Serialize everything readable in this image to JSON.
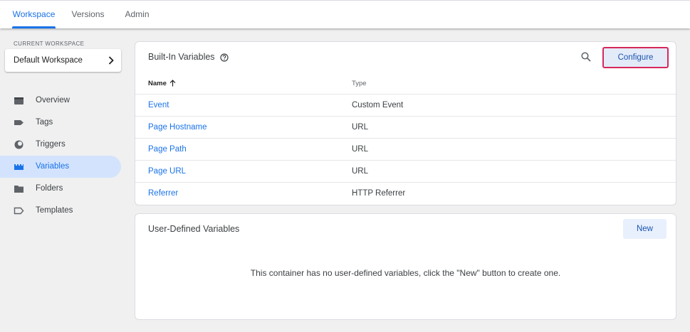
{
  "top_tabs": [
    {
      "label": "Workspace",
      "active": true
    },
    {
      "label": "Versions",
      "active": false
    },
    {
      "label": "Admin",
      "active": false
    }
  ],
  "sidebar": {
    "workspace_label": "CURRENT WORKSPACE",
    "workspace_name": "Default Workspace",
    "items": [
      {
        "label": "Overview",
        "icon": "overview-icon",
        "active": false
      },
      {
        "label": "Tags",
        "icon": "tag-icon",
        "active": false
      },
      {
        "label": "Triggers",
        "icon": "trigger-icon",
        "active": false
      },
      {
        "label": "Variables",
        "icon": "variables-icon",
        "active": true
      },
      {
        "label": "Folders",
        "icon": "folder-icon",
        "active": false
      },
      {
        "label": "Templates",
        "icon": "template-icon",
        "active": false
      }
    ]
  },
  "builtin": {
    "title": "Built-In Variables",
    "configure_label": "Configure",
    "columns": {
      "name": "Name",
      "type": "Type"
    },
    "rows": [
      {
        "name": "Event",
        "type": "Custom Event"
      },
      {
        "name": "Page Hostname",
        "type": "URL"
      },
      {
        "name": "Page Path",
        "type": "URL"
      },
      {
        "name": "Page URL",
        "type": "URL"
      },
      {
        "name": "Referrer",
        "type": "HTTP Referrer"
      }
    ]
  },
  "user_defined": {
    "title": "User-Defined Variables",
    "new_label": "New",
    "empty_message": "This container has no user-defined variables, click the \"New\" button to create one."
  },
  "colors": {
    "accent": "#1a73e8",
    "active_nav_bg": "#d3e3fd",
    "configure_highlight": "#d6285b"
  }
}
